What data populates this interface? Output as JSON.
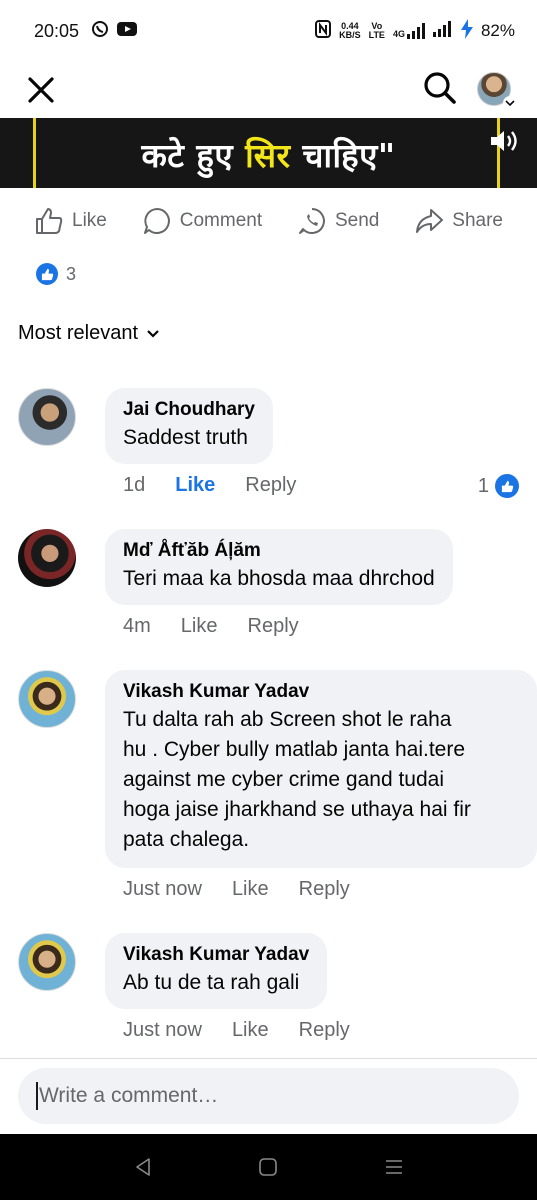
{
  "status": {
    "time": "20:05",
    "net_speed_value": "0.44",
    "net_speed_unit": "KB/S",
    "volte_top": "Vo",
    "volte_bottom": "LTE",
    "network": "4G",
    "battery": "82%"
  },
  "video": {
    "caption_pre": "कटे हुए ",
    "caption_highlight": "सिर",
    "caption_post": " चाहिए\""
  },
  "actions": {
    "like": "Like",
    "comment": "Comment",
    "send": "Send",
    "share": "Share"
  },
  "reactions": {
    "count": "3"
  },
  "sort": {
    "label": "Most relevant"
  },
  "comments": [
    {
      "name": "Jai Choudhary",
      "text": "Saddest truth",
      "time": "1d",
      "like": "Like",
      "reply": "Reply",
      "reaction_count": "1"
    },
    {
      "name": "Mď Åfťăb Áļăm",
      "text": "Teri maa ka bhosda maa dhrchod",
      "time": "4m",
      "like": "Like",
      "reply": "Reply"
    },
    {
      "name": "Vikash Kumar Yadav",
      "lines": [
        "Tu dalta rah ab Screen shot le raha",
        "hu .  Cyber bully matlab janta hai.tere",
        "against me cyber crime gand tudai",
        "hoga jaise jharkhand se uthaya hai fir",
        "pata chalega."
      ],
      "time": "Just now",
      "like": "Like",
      "reply": "Reply"
    },
    {
      "name": "Vikash Kumar Yadav",
      "text": "Ab tu de ta rah gali",
      "time": "Just now",
      "like": "Like",
      "reply": "Reply"
    }
  ],
  "composer": {
    "placeholder": "Write a comment…"
  },
  "colors": {
    "accent": "#1b74e4",
    "secondary_text": "#65676b",
    "bubble": "#f0f2f5"
  }
}
